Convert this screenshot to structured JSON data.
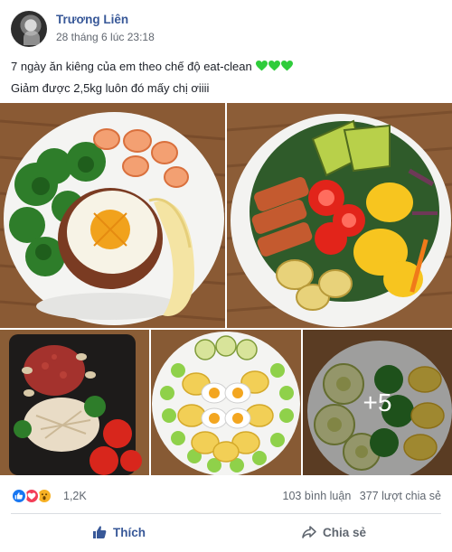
{
  "post": {
    "author": "Trương Liên",
    "timestamp": "28 tháng 6 lúc 23:18",
    "text_line1": "7 ngày ăn kiêng của em theo chế độ eat-clean",
    "text_line2": "Giảm được 2,5kg luôn đó mấy chị ơiiii",
    "emoji": [
      "green-heart",
      "green-heart",
      "green-heart"
    ]
  },
  "photos": {
    "items": [
      "food-photo-1",
      "food-photo-2",
      "food-photo-3",
      "food-photo-4",
      "food-photo-5"
    ],
    "more_label": "+5"
  },
  "reactions": {
    "icons": [
      "like-reaction",
      "love-reaction",
      "wow-reaction"
    ],
    "count": "1,2K",
    "comments": "103 bình luận",
    "shares": "377 lượt chia sẻ"
  },
  "actions": {
    "like_label": "Thích",
    "share_label": "Chia sẻ"
  },
  "colors": {
    "link": "#385898",
    "like_blue": "#1877f2",
    "love_red": "#f33e58",
    "wow_yellow": "#f7b125",
    "green_heart": "#2fcc3b"
  }
}
